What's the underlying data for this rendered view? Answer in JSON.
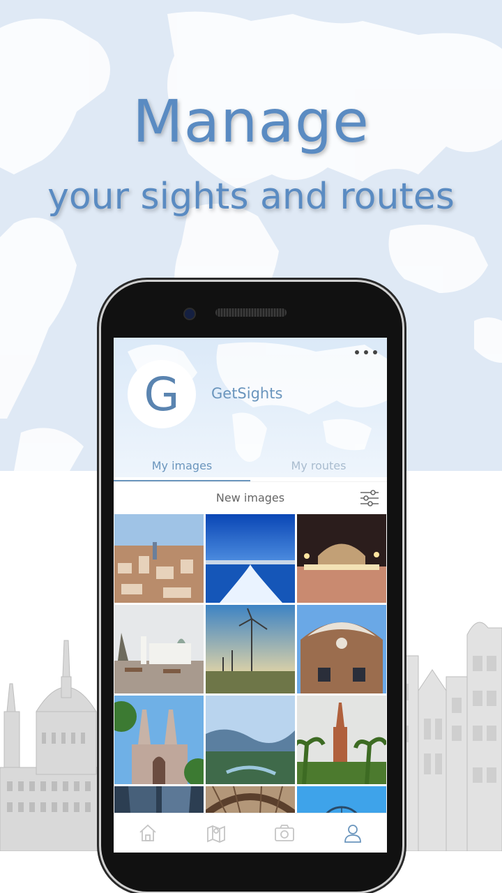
{
  "headline": {
    "title": "Manage",
    "subtitle": "your sights and routes"
  },
  "profile": {
    "avatar_letter": "G",
    "username": "GetSights",
    "more_icon": "more-dots-icon"
  },
  "tabs": [
    {
      "label": "My images",
      "active": true
    },
    {
      "label": "My routes",
      "active": false
    }
  ],
  "subbar": {
    "label": "New images",
    "filter_icon": "filter-sliders-icon"
  },
  "gallery": [
    {
      "name": "barcelona-city-photo"
    },
    {
      "name": "boat-wake-sea-photo"
    },
    {
      "name": "fountain-night-photo"
    },
    {
      "name": "cathedral-square-photo"
    },
    {
      "name": "wind-turbines-photo"
    },
    {
      "name": "gaudi-house-photo"
    },
    {
      "name": "gothic-church-photo"
    },
    {
      "name": "mountain-valley-photo"
    },
    {
      "name": "palm-tower-photo"
    },
    {
      "name": "skyscraper-photo"
    },
    {
      "name": "glass-roof-photo"
    },
    {
      "name": "ferris-wheel-photo"
    }
  ],
  "bottom_nav": [
    {
      "icon": "home-icon",
      "active": false
    },
    {
      "icon": "map-icon",
      "active": false
    },
    {
      "icon": "camera-icon",
      "active": false
    },
    {
      "icon": "profile-icon",
      "active": true
    }
  ],
  "colors": {
    "accent": "#6a95bd",
    "headline": "#5a8bc2",
    "map_bg": "#dfe9f5"
  }
}
